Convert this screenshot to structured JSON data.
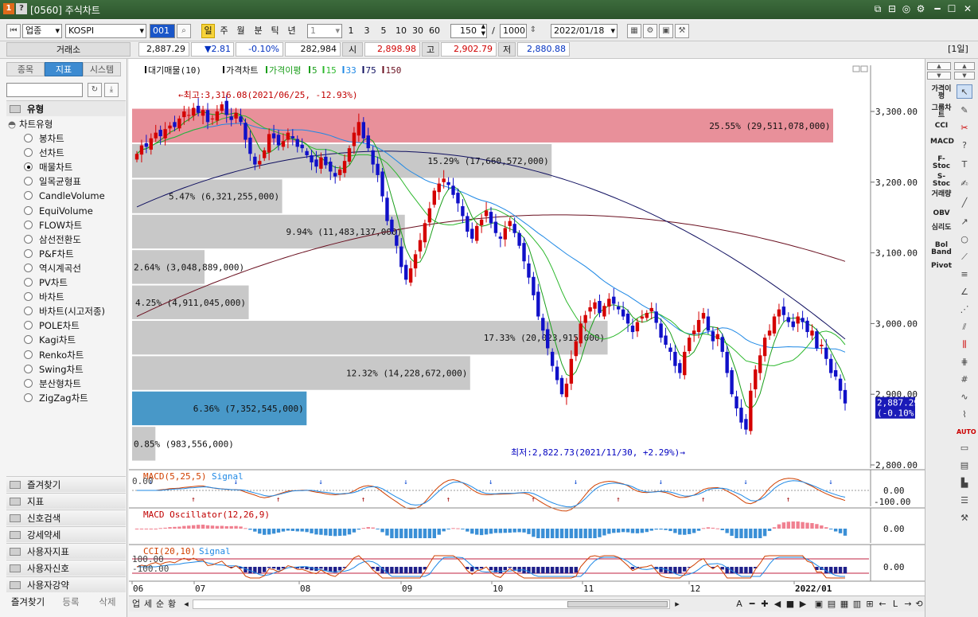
{
  "window": {
    "badge_1": "1",
    "badge_2": "?",
    "title": "[0560] 주식차트"
  },
  "toolbar": {
    "market_type": "업종",
    "symbol": "KOSPI",
    "code": "001",
    "periods": [
      "일",
      "주",
      "월",
      "분",
      "틱",
      "년"
    ],
    "active_period": "일",
    "minute_select": "1",
    "intervals": [
      "1",
      "3",
      "5",
      "10",
      "30",
      "60"
    ],
    "count": "150",
    "slash": "/",
    "max_count": "1000",
    "date": "2022/01/18"
  },
  "quote": {
    "exchange_label": "거래소",
    "price": "2,887.29",
    "change": "▼2.81",
    "change_pct": "-0.10%",
    "volume": "282,984",
    "open_label": "시",
    "open": "2,898.98",
    "high_label": "고",
    "high": "2,902.79",
    "low_label": "저",
    "low": "2,880.88",
    "period_badge": "[1일]"
  },
  "left_panel": {
    "tabs": [
      "종목",
      "지표",
      "시스템"
    ],
    "active_tab": "지표",
    "section_title": "유형",
    "group_title": "차트유형",
    "chart_types": [
      "봉차트",
      "선차트",
      "매물차트",
      "일목균형표",
      "CandleVolume",
      "EquiVolume",
      "FLOW차트",
      "삼선전환도",
      "P&F차트",
      "역시계곡선",
      "PV차트",
      "바차트",
      "바차트(시고저종)",
      "POLE차트",
      "Kagi차트",
      "Renko차트",
      "Swing차트",
      "분산형차트",
      "ZigZag차트"
    ],
    "selected_type": "매물차트",
    "folders": [
      "즐겨찾기",
      "지표",
      "신호검색",
      "강세약세",
      "사용자지표",
      "사용자신호",
      "사용자강약"
    ],
    "bottom_tabs": [
      "즐겨찾기",
      "등록",
      "삭제"
    ]
  },
  "right_toolbar": {
    "indicators": [
      "가격이평",
      "그룹차트",
      "CCI",
      "MACD",
      "F-Stoc",
      "S-Stoc",
      "거래량",
      "OBV",
      "심리도",
      "Bol Band",
      "Pivot"
    ]
  },
  "bottom_bar": {
    "buttons": [
      "업",
      "세",
      "순",
      "황"
    ]
  },
  "colors": {
    "up": "#d40000",
    "down": "#1010c8",
    "ma5": "#1a9e1a",
    "ma15": "#2db82d",
    "ma33": "#1e88e5",
    "ma75": "#101060",
    "ma150": "#6a1020",
    "profile_bar": "#c8c8c8",
    "profile_max": "#e8909a",
    "profile_current": "#4898c8"
  },
  "chart_data": [
    {
      "type": "candlestick",
      "legend": [
        "대기매물(10)",
        "가격차트",
        "가격이평",
        "5",
        "15",
        "33",
        "75",
        "150"
      ],
      "y_ticks": [
        "3,300.00",
        "3,200.00",
        "3,100.00",
        "3,000.00",
        "2,900.00",
        "2,800.00"
      ],
      "ylim": [
        2800,
        3300
      ],
      "x_ticks": [
        "06",
        "07",
        "08",
        "09",
        "10",
        "11",
        "12",
        "2022/01"
      ],
      "high_annotation": "←최고:3,316.08(2021/06/25, -12.93%)",
      "low_annotation": "최저:2,822.73(2021/11/30, +2.29%)→",
      "current_price_tag": "2,887.29",
      "current_change_tag": "(-0.10%)",
      "volume_profile": [
        {
          "label": "25.55% (29,511,078,000)",
          "pct": 25.55,
          "low": 3255,
          "high": 3305
        },
        {
          "label": "15.29% (17,660,572,000)",
          "pct": 15.29,
          "low": 3205,
          "high": 3255
        },
        {
          "label": "5.47% (6,321,255,000)",
          "pct": 5.47,
          "low": 3155,
          "high": 3205
        },
        {
          "label": "9.94% (11,483,137,000)",
          "pct": 9.94,
          "low": 3105,
          "high": 3155
        },
        {
          "label": "2.64% (3,048,889,000)",
          "pct": 2.64,
          "low": 3055,
          "high": 3105
        },
        {
          "label": "4.25% (4,911,045,000)",
          "pct": 4.25,
          "low": 3005,
          "high": 3055
        },
        {
          "label": "17.33% (20,023,915,000)",
          "pct": 17.33,
          "low": 2955,
          "high": 3005
        },
        {
          "label": "12.32% (14,228,672,000)",
          "pct": 12.32,
          "low": 2905,
          "high": 2955
        },
        {
          "label": "6.36% (7,352,545,000)",
          "pct": 6.36,
          "low": 2855,
          "high": 2905
        },
        {
          "label": "0.85% (983,556,000)",
          "pct": 0.85,
          "low": 2805,
          "high": 2855
        }
      ],
      "close": [
        3240,
        3252,
        3250,
        3262,
        3270,
        3265,
        3275,
        3280,
        3278,
        3290,
        3300,
        3295,
        3305,
        3298,
        3302,
        3285,
        3290,
        3300,
        3310,
        3295,
        3288,
        3298,
        3285,
        3260,
        3240,
        3225,
        3230,
        3245,
        3268,
        3262,
        3252,
        3258,
        3270,
        3262,
        3250,
        3248,
        3238,
        3228,
        3222,
        3235,
        3224,
        3215,
        3208,
        3218,
        3230,
        3248,
        3270,
        3285,
        3262,
        3248,
        3225,
        3210,
        3180,
        3145,
        3130,
        3110,
        3080,
        3062,
        3078,
        3098,
        3118,
        3142,
        3163,
        3188,
        3198,
        3205,
        3196,
        3182,
        3170,
        3152,
        3130,
        3120,
        3138,
        3147,
        3160,
        3142,
        3128,
        3120,
        3135,
        3145,
        3128,
        3110,
        3088,
        3065,
        3040,
        3010,
        2990,
        2965,
        2940,
        2920,
        2900,
        2915,
        2950,
        2975,
        3000,
        3012,
        3023,
        3030,
        3015,
        3025,
        3035,
        3028,
        3020,
        3010,
        3000,
        2988,
        3002,
        3010,
        3015,
        3022,
        3001,
        2980,
        2970,
        2960,
        2940,
        2930,
        2960,
        2980,
        2990,
        3005,
        3015,
        2990,
        2975,
        2985,
        2960,
        2930,
        2900,
        2880,
        2860,
        2850,
        2905,
        2935,
        2955,
        2980,
        2990,
        3010,
        3020,
        3012,
        3002,
        2995,
        3010,
        3002,
        2988,
        2990,
        2965,
        2970,
        2950,
        2930,
        2925,
        2905,
        2887
      ],
      "ma75_endpoints": {
        "start": 3165,
        "mid": 3230,
        "end": 2978
      },
      "ma150_endpoints": {
        "start": 3010,
        "mid": 3150,
        "end": 3088
      }
    },
    {
      "type": "line",
      "title": "MACD(5,25,5)",
      "legend": [
        "MACD(5,25,5)",
        "Signal"
      ],
      "y_ticks": [
        "0.00",
        "-100.00"
      ],
      "left_tick": "0.00"
    },
    {
      "type": "bar",
      "title": "MACD Oscillator(12,26,9)",
      "y_ticks": [
        "0.00"
      ]
    },
    {
      "type": "line",
      "title": "CCI(20,10)",
      "legend": [
        "CCI(20,10)",
        "Signal"
      ],
      "y_ticks": [
        "0.00"
      ],
      "left_ticks": [
        "100.00",
        "-100.00"
      ]
    }
  ]
}
